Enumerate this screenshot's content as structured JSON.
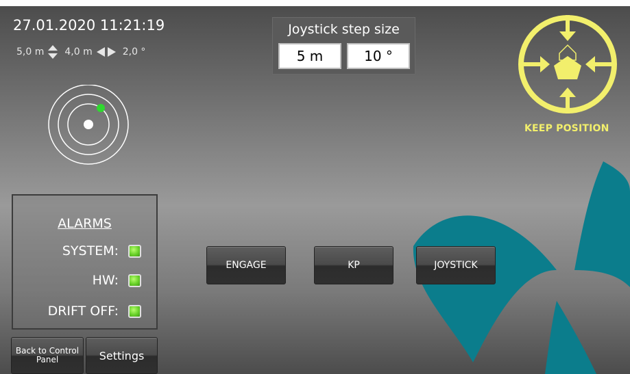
{
  "header": {
    "datetime": "27.01.2020 11:21:19",
    "readouts": [
      {
        "value": "5,0 m",
        "icon": "up-down-arrows-icon"
      },
      {
        "value": "4,0 m",
        "icon": "left-right-arrows-icon"
      },
      {
        "value": "2,0 °"
      }
    ]
  },
  "joystick_step": {
    "title": "Joystick step size",
    "distance": "5 m",
    "angle": "10 °"
  },
  "mode": {
    "label": "KEEP POSITION",
    "icon": "keep-position-icon",
    "color": "#f2ef6c"
  },
  "alarms": {
    "title": "ALARMS",
    "items": [
      {
        "label": "SYSTEM:",
        "status": "ok"
      },
      {
        "label": "HW:",
        "status": "ok"
      },
      {
        "label": "DRIFT OFF:",
        "status": "ok"
      }
    ]
  },
  "buttons": {
    "engage": "ENGAGE",
    "kp": "KP",
    "joystick": "JOYSTICK",
    "back": "Back to Control Panel",
    "settings": "Settings"
  },
  "colors": {
    "accent_teal": "#0b7d8c",
    "led_green": "#69d12a",
    "radar_target": "#2fd92f"
  }
}
